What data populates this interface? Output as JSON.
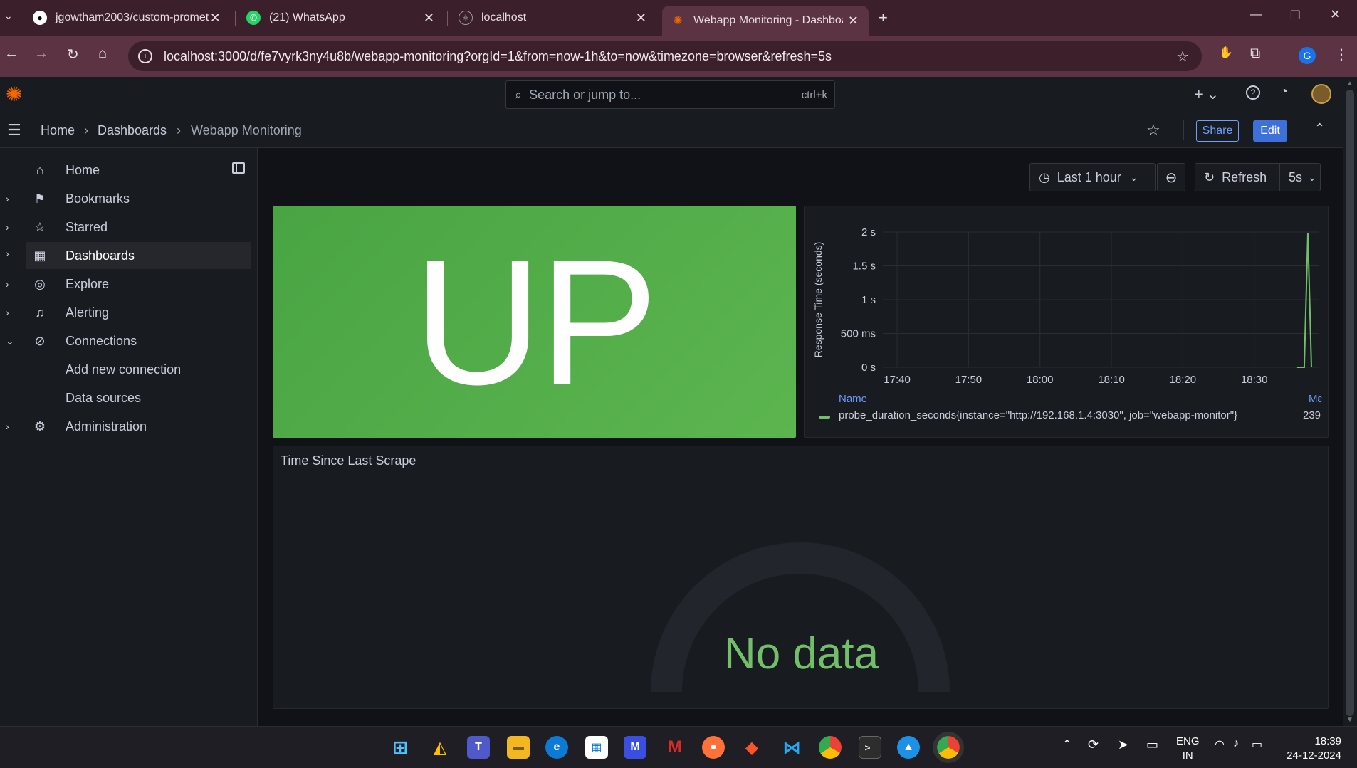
{
  "browser": {
    "tabs": [
      {
        "title": "jgowtham2003/custom-promet",
        "icon": "github-icon"
      },
      {
        "title": "(21) WhatsApp",
        "icon": "whatsapp-icon"
      },
      {
        "title": "localhost",
        "icon": "react-icon"
      },
      {
        "title": "Webapp Monitoring - Dashboa",
        "icon": "grafana-icon",
        "active": true
      }
    ],
    "url": "localhost:3000/d/fe7vyrk3ny4u8b/webapp-monitoring?orgId=1&from=now-1h&to=now&timezone=browser&refresh=5s",
    "profile_initial": "G"
  },
  "topbar": {
    "search_placeholder": "Search or jump to...",
    "search_shortcut": "ctrl+k"
  },
  "breadcrumb": [
    "Home",
    "Dashboards",
    "Webapp Monitoring"
  ],
  "actions": {
    "share": "Share",
    "edit": "Edit"
  },
  "toolbar": {
    "time_range": "Last 1 hour",
    "refresh": "Refresh",
    "interval": "5s"
  },
  "sidebar": {
    "items": [
      {
        "label": "Home",
        "icon": "home-icon",
        "chevron": ""
      },
      {
        "label": "Bookmarks",
        "icon": "bookmark-icon",
        "chevron": "›"
      },
      {
        "label": "Starred",
        "icon": "star-icon",
        "chevron": "›"
      },
      {
        "label": "Dashboards",
        "icon": "apps-icon",
        "chevron": "›",
        "selected": true
      },
      {
        "label": "Explore",
        "icon": "compass-icon",
        "chevron": "›"
      },
      {
        "label": "Alerting",
        "icon": "bell-icon",
        "chevron": "›"
      },
      {
        "label": "Connections",
        "icon": "link-icon",
        "chevron": "⌄"
      },
      {
        "label": "Add new connection",
        "icon": "",
        "chevron": ""
      },
      {
        "label": "Data sources",
        "icon": "",
        "chevron": ""
      },
      {
        "label": "Administration",
        "icon": "gear-icon",
        "chevron": "›"
      }
    ]
  },
  "panels": {
    "status": {
      "value": "UP",
      "color": "#56a64b"
    },
    "gauge": {
      "title": "Time Since Last Scrape",
      "value": "No data"
    }
  },
  "chart_data": {
    "type": "line",
    "ylabel": "Response Time (seconds)",
    "y_ticks": [
      "0 s",
      "500 ms",
      "1 s",
      "1.5 s",
      "2 s"
    ],
    "ylim": [
      0,
      2
    ],
    "x_ticks": [
      "17:40",
      "17:50",
      "18:00",
      "18:10",
      "18:20",
      "18:30"
    ],
    "legend_header": "Name",
    "legend_header_right": "Mε",
    "series": [
      {
        "name": "probe_duration_seconds{instance=\"http://192.168.1.4:3030\", job=\"webapp-monitor\"}",
        "color": "#73bf69",
        "last_value": "239",
        "x": [
          "18:36",
          "18:37",
          "18:37.5",
          "18:38"
        ],
        "values": [
          0,
          0,
          1.98,
          0
        ]
      }
    ]
  },
  "taskbar": {
    "lang": "ENG",
    "region": "IN",
    "time": "18:39",
    "date": "24-12-2024"
  }
}
